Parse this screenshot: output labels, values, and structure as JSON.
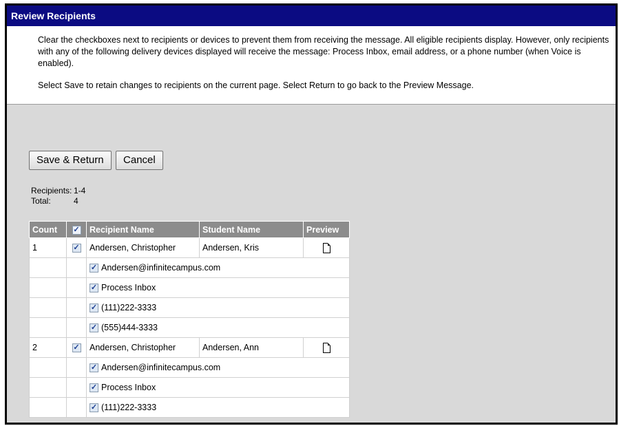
{
  "title": "Review Recipients",
  "intro": {
    "p1": "Clear the checkboxes next to recipients or devices to prevent them from receiving the message. All eligible recipients display. However, only recipients with any of the following delivery devices displayed will receive the message: Process Inbox, email address, or a phone number (when Voice is enabled).",
    "p2": "Select Save to retain changes to recipients on the current page. Select Return to go back to the Preview Message."
  },
  "buttons": {
    "save_return": "Save & Return",
    "cancel": "Cancel"
  },
  "summary": {
    "recipients_label": "Recipients:",
    "recipients_value": "1-4",
    "total_label": "Total:",
    "total_value": "4"
  },
  "table": {
    "headers": {
      "count": "Count",
      "recipient": "Recipient Name",
      "student": "Student Name",
      "preview": "Preview"
    },
    "rows": [
      {
        "count": "1",
        "recipient": "Andersen, Christopher",
        "student": "Andersen, Kris",
        "devices": [
          "Andersen@infinitecampus.com",
          "Process Inbox",
          "(111)222-3333",
          "(555)444-3333"
        ]
      },
      {
        "count": "2",
        "recipient": "Andersen, Christopher",
        "student": "Andersen, Ann",
        "devices": [
          "Andersen@infinitecampus.com",
          "Process Inbox",
          "(111)222-3333"
        ]
      }
    ]
  },
  "icons": {
    "checkbox": "checked-checkbox-icon",
    "preview": "document-icon"
  },
  "colors": {
    "titlebar": "#0b0b82",
    "header": "#8c8c8c",
    "panel": "#d9d9d9"
  }
}
